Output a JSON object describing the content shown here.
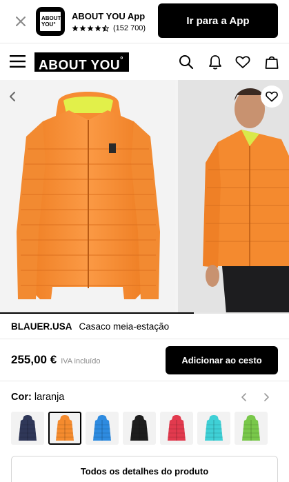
{
  "banner": {
    "app_name": "ABOUT YOU App",
    "rating_count": "(152 700)",
    "logo_line1": "ABOUT",
    "logo_line2": "YOU°",
    "cta": "Ir para a App",
    "rating": 4.5
  },
  "header": {
    "logo_text": "ABOUT YOU",
    "logo_mark": "°",
    "icons": [
      "menu-icon",
      "search-icon",
      "bell-icon",
      "heart-icon",
      "shopping-bag-icon"
    ]
  },
  "gallery": {
    "progress": 0.67
  },
  "product": {
    "brand": "BLAUER.USA",
    "name": "Casaco meia-estação",
    "price": "255,00 €",
    "vat_note": "IVA incluído",
    "add_to_cart": "Adicionar ao cesto"
  },
  "color": {
    "label": "Cor:",
    "value": "laranja",
    "swatches": [
      {
        "color": "#2f3758"
      },
      {
        "color": "#f58b2e"
      },
      {
        "color": "#2e8be0"
      },
      {
        "color": "#1d1d1d"
      },
      {
        "color": "#e23a4e"
      },
      {
        "color": "#3fd0d6"
      },
      {
        "color": "#79c84a"
      }
    ],
    "selected_index": 1
  },
  "details_button": "Todos os detalhes do produto",
  "colors": {
    "accent": "#000000",
    "jacket_orange": "#f6923a",
    "lining_yellow": "#e2f04a"
  }
}
